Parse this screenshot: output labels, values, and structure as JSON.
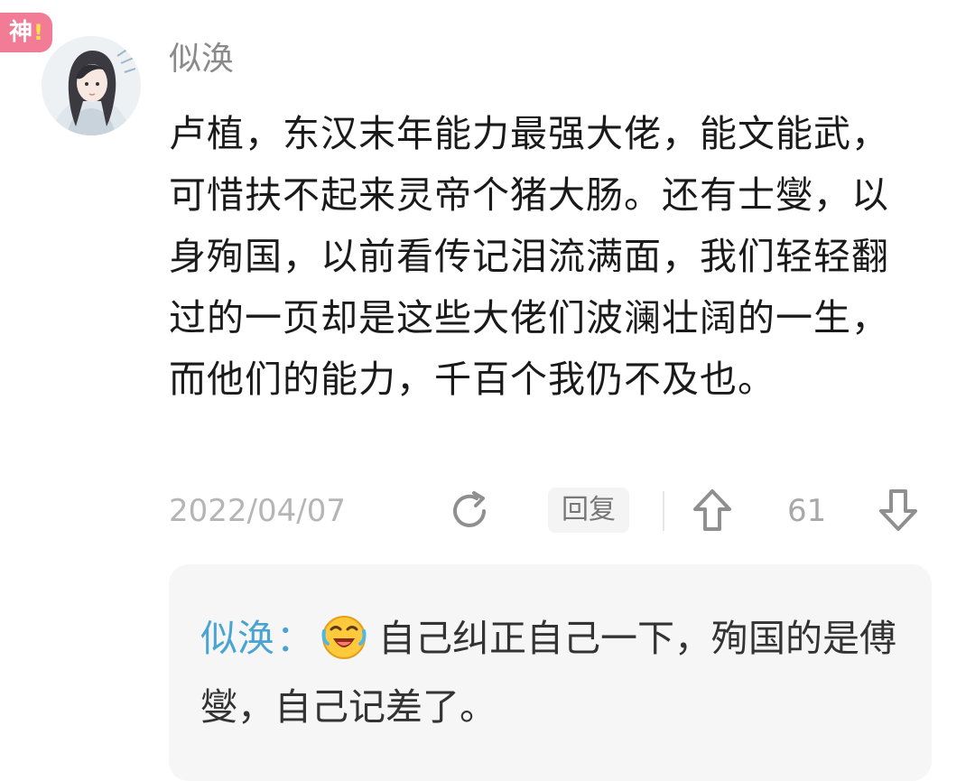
{
  "badge": {
    "label": "神",
    "mark": "!"
  },
  "comment": {
    "username": "似涣",
    "text": "卢植，东汉末年能力最强大佬，能文能武，可惜扶不起来灵帝个猪大肠。还有士燮，以身殉国，以前看传记泪流满面，我们轻轻翻过的一页却是这些大佬们波澜壮阔的一生，而他们的能力，千百个我仍不及也。",
    "date": "2022/04/07",
    "reply_label": "回复",
    "like_count": "61"
  },
  "reply": {
    "author": "似涣",
    "separator": "：",
    "emoji": "laughing-crying-emoji",
    "text": "自己纠正自己一下，殉国的是傅燮，自己记差了。"
  },
  "icons": {
    "share": "share-icon",
    "upvote": "upvote-icon",
    "downvote": "downvote-icon"
  },
  "colors": {
    "badge": "#f27b95",
    "reply_author": "#4aa3d1",
    "date": "#b5b5b5",
    "reply_box_bg": "#f6f6f6"
  }
}
